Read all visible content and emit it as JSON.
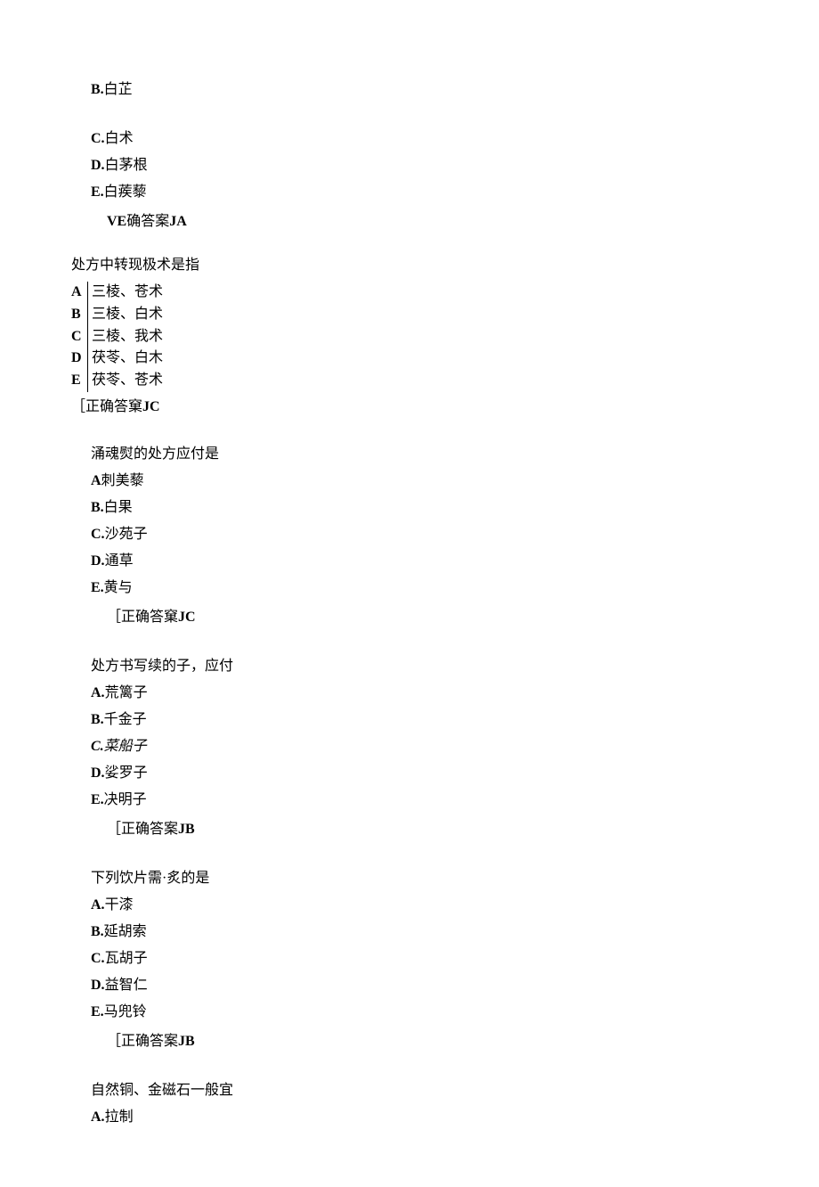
{
  "q1": {
    "b": "B.白芷",
    "c": "C.白术",
    "d": "D.白茅根",
    "e": "E.白蒺藜",
    "answer": "VE确答案JA"
  },
  "q2": {
    "stem": "处方中转现极术是指",
    "rows": [
      {
        "label": "A",
        "text": "三棱、苍术"
      },
      {
        "label": "B",
        "text": "三棱、白术"
      },
      {
        "label": "C",
        "text": "三棱、我术"
      },
      {
        "label": "D",
        "text": "茯苓、白木"
      },
      {
        "label": "E",
        "text": "茯苓、苍术"
      }
    ],
    "answer": "［正确答窠JC"
  },
  "q3": {
    "stem": "涌魂熨的处方应付是",
    "a": "A刺美藜",
    "b": "B.白果",
    "c": "C.沙苑子",
    "d": "D.通草",
    "e": "E.黄与",
    "answer": "［正确答窠JC"
  },
  "q4": {
    "stem": "处方书写续的子，应付",
    "a": "A.荒篱子",
    "b": "B.千金子",
    "c": "C.菜船子",
    "d": "D.娑罗子",
    "e": "E.决明子",
    "answer": "［正确答案JB"
  },
  "q5": {
    "stem": "下列饮片需·炙的是",
    "a": "A.干漆",
    "b": "B.延胡索",
    "c": "C.瓦胡子",
    "d": "D.益智仁",
    "e": "E.马兜铃",
    "answer": "［正确答案JB"
  },
  "q6": {
    "stem": "自然铜、金磁石一般宜",
    "a": "A.拉制"
  }
}
